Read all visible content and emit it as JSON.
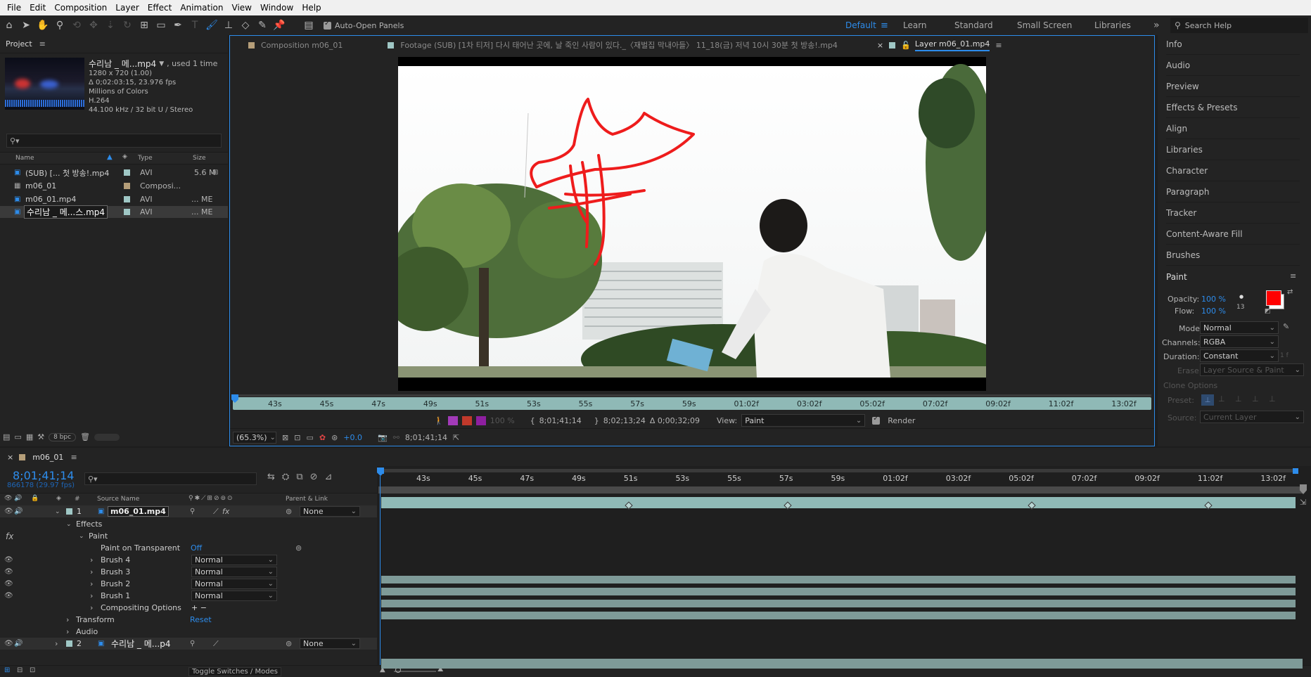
{
  "menu": [
    "File",
    "Edit",
    "Composition",
    "Layer",
    "Effect",
    "Animation",
    "View",
    "Window",
    "Help"
  ],
  "toolbar": {
    "auto_open_label": "Auto-Open Panels",
    "workspaces": [
      "Default",
      "Learn",
      "Standard",
      "Small Screen",
      "Libraries"
    ],
    "active_workspace": "Default",
    "search_placeholder": "Search Help"
  },
  "project": {
    "title": "Project",
    "footage_name": "수리남 _ 메...mp4",
    "used": ", used 1 time",
    "info": [
      "1280 x 720 (1.00)",
      "Δ 0;02:03:15, 23.976 fps",
      "Millions of Colors",
      "H.264",
      "44.100 kHz / 32 bit U / Stereo"
    ],
    "columns": {
      "name": "Name",
      "type": "Type",
      "size": "Size"
    },
    "items": [
      {
        "name": "(SUB) [... 첫 방송!.mp4",
        "type": "AVI",
        "size": "5.6 M",
        "color": "#9fc7c5"
      },
      {
        "name": "m06_01",
        "type": "Composi...",
        "size": "",
        "color": "#b59e79"
      },
      {
        "name": "m06_01.mp4",
        "type": "AVI",
        "size": "... ME",
        "color": "#9fc7c5"
      },
      {
        "name": "수리남 _ 메...스.mp4",
        "type": "AVI",
        "size": "... ME",
        "color": "#9fc7c5"
      }
    ],
    "bpc": "8 bpc"
  },
  "viewer": {
    "tabs": [
      {
        "label": "Composition m06_01"
      },
      {
        "label": "Footage (SUB) [1차 티저] 다시 태어난 곳에, 날 죽인 사람이 있다._〈재벌집 막내아들〉 11_18(금) 저녁 10시 30분 첫 방송!.mp4"
      },
      {
        "label": "Layer m06_01.mp4"
      }
    ],
    "ruler_ticks": [
      "43s",
      "45s",
      "47s",
      "49s",
      "51s",
      "53s",
      "55s",
      "57s",
      "59s",
      "01:02f",
      "03:02f",
      "05:02f",
      "07:02f",
      "09:02f",
      "11:02f",
      "13:02f"
    ],
    "in_time": "8;01;41;14",
    "out_time": "8;02;13;24",
    "duration": "Δ 0;00;32;09",
    "view_label": "View:",
    "view_value": "Paint",
    "render_label": "Render",
    "opacity_pct": "100 %",
    "zoom": "(65.3%)",
    "exposure": "+0.0",
    "current_time": "8;01;41;14"
  },
  "right_panel": {
    "items": [
      "Info",
      "Audio",
      "Preview",
      "Effects & Presets",
      "Align",
      "Libraries",
      "Character",
      "Paragraph",
      "Tracker",
      "Content-Aware Fill",
      "Brushes"
    ],
    "paint": {
      "title": "Paint",
      "opacity_label": "Opacity:",
      "opacity_value": "100 %",
      "flow_label": "Flow:",
      "flow_value": "100 %",
      "brush_size": "13",
      "mode_label": "Mode:",
      "mode_value": "Normal",
      "channels_label": "Channels:",
      "channels_value": "RGBA",
      "duration_label": "Duration:",
      "duration_value": "Constant",
      "erase_label": "Erase:",
      "erase_value": "Layer Source & Paint",
      "clone_label": "Clone Options",
      "preset_label": "Preset:",
      "source_label": "Source:",
      "source_value": "Current Layer",
      "fg_color": "#ff0000",
      "bg_color": "#ffffff"
    }
  },
  "timeline": {
    "comp_name": "m06_01",
    "timecode": "8;01;41;14",
    "frames": "866178 (29.97 fps)",
    "columns": {
      "source": "Source Name",
      "parent": "Parent & Link"
    },
    "layer1": {
      "num": "1",
      "name": "m06_01.mp4",
      "parent": "None"
    },
    "layer2": {
      "num": "2",
      "name": "수리남 _ 메...p4",
      "parent": "None"
    },
    "effects_label": "Effects",
    "paint_label": "Paint",
    "paint_on_transparent": "Paint on Transparent",
    "paint_on_value": "Off",
    "brushes": [
      {
        "label": "Brush 4",
        "mode": "Normal"
      },
      {
        "label": "Brush 3",
        "mode": "Normal"
      },
      {
        "label": "Brush 2",
        "mode": "Normal"
      },
      {
        "label": "Brush 1",
        "mode": "Normal"
      }
    ],
    "compositing": "Compositing Options",
    "compositing_value": "+ −",
    "transform_label": "Transform",
    "transform_value": "Reset",
    "audio_label": "Audio",
    "toggle_label": "Toggle Switches / Modes",
    "ruler_ticks": [
      "43s",
      "45s",
      "47s",
      "49s",
      "51s",
      "53s",
      "55s",
      "57s",
      "59s",
      "01:02f",
      "03:02f",
      "05:02f",
      "07:02f",
      "09:02f",
      "11:02f",
      "13:02f"
    ]
  }
}
